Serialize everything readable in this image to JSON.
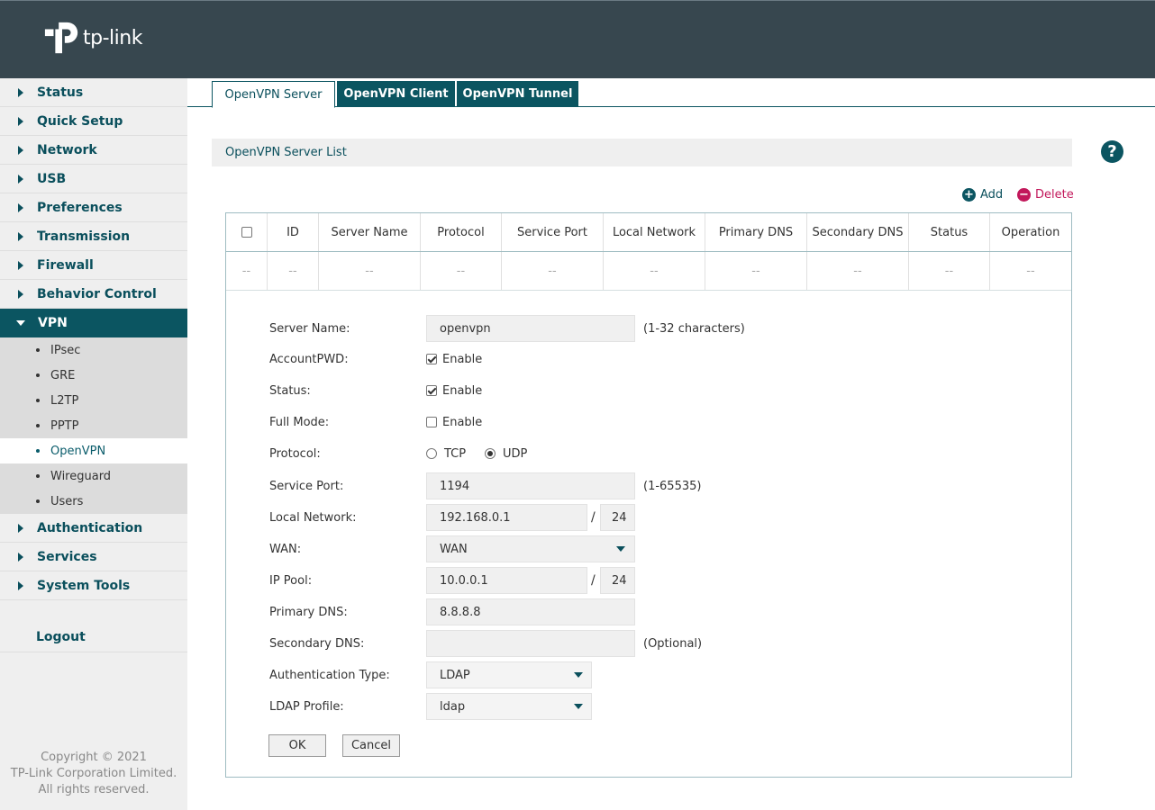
{
  "brand": {
    "name": "tp-link"
  },
  "sidebar": {
    "items_before": [
      {
        "label": "Status"
      },
      {
        "label": "Quick Setup"
      },
      {
        "label": "Network"
      },
      {
        "label": "USB"
      },
      {
        "label": "Preferences"
      },
      {
        "label": "Transmission"
      },
      {
        "label": "Firewall"
      },
      {
        "label": "Behavior Control"
      }
    ],
    "active": {
      "label": "VPN"
    },
    "sub_items": [
      {
        "label": "IPsec"
      },
      {
        "label": "GRE"
      },
      {
        "label": "L2TP"
      },
      {
        "label": "PPTP"
      },
      {
        "label": "OpenVPN"
      },
      {
        "label": "Wireguard"
      },
      {
        "label": "Users"
      }
    ],
    "items_after": [
      {
        "label": "Authentication"
      },
      {
        "label": "Services"
      },
      {
        "label": "System Tools"
      }
    ],
    "logout": "Logout",
    "copyright": [
      "Copyright © 2021",
      "TP-Link Corporation Limited.",
      "All rights reserved."
    ]
  },
  "tabs": [
    {
      "label": "OpenVPN Server",
      "active": true
    },
    {
      "label": "OpenVPN Client",
      "active": false
    },
    {
      "label": "OpenVPN Tunnel",
      "active": false
    }
  ],
  "section": {
    "title": "OpenVPN Server List",
    "help": "?"
  },
  "actions": {
    "add": "Add",
    "delete": "Delete",
    "add_color": "#0b5561",
    "delete_color": "#c2185b"
  },
  "table": {
    "headers": [
      "ID",
      "Server Name",
      "Protocol",
      "Service Port",
      "Local Network",
      "Primary DNS",
      "Secondary DNS",
      "Status",
      "Operation"
    ],
    "empty_row": [
      "--",
      "--",
      "--",
      "--",
      "--",
      "--",
      "--",
      "--",
      "--",
      "--"
    ]
  },
  "form": {
    "server_name": {
      "label": "Server Name:",
      "value": "openvpn",
      "hint": "(1-32 characters)"
    },
    "account_pwd": {
      "label": "AccountPWD:",
      "option": "Enable",
      "checked": true
    },
    "status": {
      "label": "Status:",
      "option": "Enable",
      "checked": true
    },
    "full_mode": {
      "label": "Full Mode:",
      "option": "Enable",
      "checked": false
    },
    "protocol": {
      "label": "Protocol:",
      "options": [
        "TCP",
        "UDP"
      ],
      "selected": "UDP"
    },
    "service_port": {
      "label": "Service Port:",
      "value": "1194",
      "hint": "(1-65535)"
    },
    "local_network": {
      "label": "Local Network:",
      "ip": "192.168.0.1",
      "mask": "24",
      "sep": "/"
    },
    "wan": {
      "label": "WAN:",
      "value": "WAN"
    },
    "ip_pool": {
      "label": "IP Pool:",
      "ip": "10.0.0.1",
      "mask": "24",
      "sep": "/"
    },
    "primary_dns": {
      "label": "Primary DNS:",
      "value": "8.8.8.8"
    },
    "secondary_dns": {
      "label": "Secondary DNS:",
      "value": "",
      "hint": "(Optional)"
    },
    "auth_type": {
      "label": "Authentication Type:",
      "value": "LDAP"
    },
    "ldap_profile": {
      "label": "LDAP Profile:",
      "value": "ldap"
    },
    "ok": "OK",
    "cancel": "Cancel"
  }
}
